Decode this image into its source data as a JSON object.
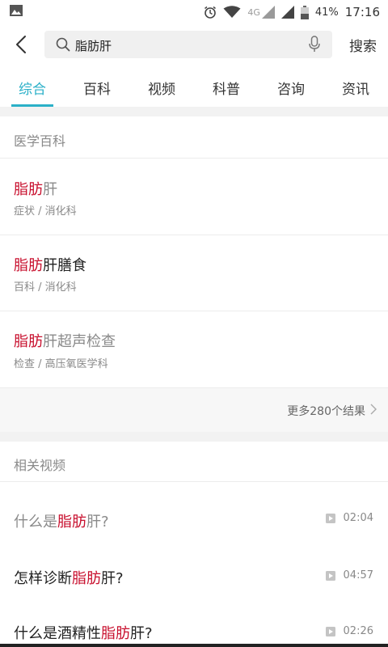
{
  "status_bar": {
    "network": "4G",
    "battery": "41%",
    "time": "17:16"
  },
  "search": {
    "query": "脂肪肝",
    "button": "搜索"
  },
  "tabs": [
    "综合",
    "百科",
    "视频",
    "科普",
    "咨询",
    "资讯"
  ],
  "encyclopedia": {
    "title": "医学百科",
    "items": [
      {
        "highlight": "脂肪",
        "rest": "肝",
        "category": "症状 / 消化科"
      },
      {
        "highlight": "脂肪",
        "rest": "肝膳食",
        "category": "百科 / 消化科"
      },
      {
        "highlight": "脂肪",
        "rest": "肝超声检查",
        "category": "检查 / 高压氧医学科"
      }
    ],
    "more": "更多280个结果"
  },
  "videos": {
    "title": "相关视频",
    "items": [
      {
        "pre": "什么是",
        "highlight": "脂肪",
        "post": "肝?",
        "duration": "02:04"
      },
      {
        "pre": "怎样诊断",
        "highlight": "脂肪",
        "post": "肝?",
        "duration": "04:57"
      },
      {
        "pre": "什么是酒精性",
        "highlight": "脂肪",
        "post": "肝?",
        "duration": "02:26"
      }
    ]
  },
  "colors": {
    "accent": "#2bb0c8",
    "highlight": "#c8102e"
  }
}
